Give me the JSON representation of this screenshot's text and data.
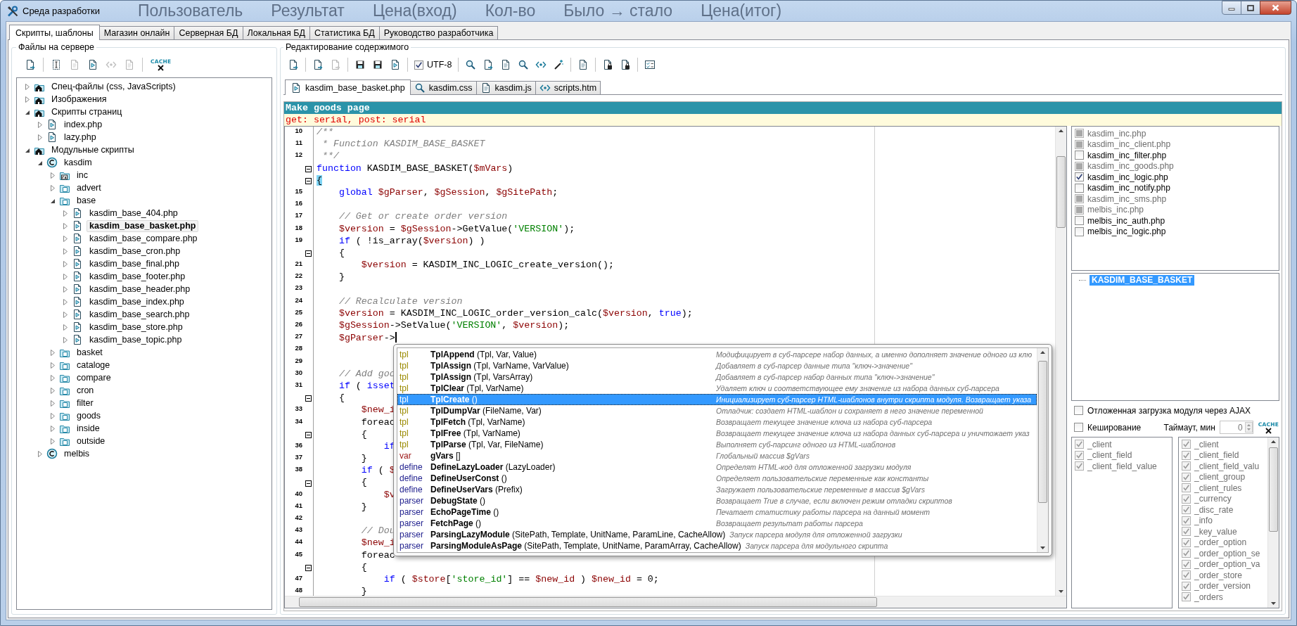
{
  "window": {
    "title": "Среда разработки",
    "backdrop_texts": [
      "Пользователь",
      "Результат",
      "Цена(вход)",
      "Кол-во",
      "Было → стало",
      "Цена(итог)"
    ]
  },
  "tabs": [
    {
      "label": "Скрипты, шаблоны",
      "selected": true
    },
    {
      "label": "Магазин онлайн",
      "selected": false
    },
    {
      "label": "Серверная БД",
      "selected": false
    },
    {
      "label": "Локальная БД",
      "selected": false
    },
    {
      "label": "Статистика БД",
      "selected": false
    },
    {
      "label": "Руководство разработчика",
      "selected": false
    }
  ],
  "files_panel": {
    "title": "Файлы на сервере",
    "toolbar": [
      [
        {
          "kind": "button",
          "disabled": false
        }
      ],
      [
        {
          "kind": "button",
          "disabled": false
        },
        {
          "kind": "button",
          "disabled": true
        },
        {
          "kind": "button",
          "disabled": false
        },
        {
          "kind": "button",
          "disabled": true
        },
        {
          "kind": "button",
          "disabled": true
        }
      ],
      [
        {
          "kind": "cache",
          "label": "CACHE"
        }
      ]
    ],
    "tree": [
      {
        "kind": "section",
        "label": "Спец-файлы (css, JavaScripts)",
        "expanded": false,
        "selected": false
      },
      {
        "kind": "section",
        "label": "Изображения",
        "expanded": false,
        "selected": false
      },
      {
        "kind": "section",
        "label": "Скрипты страниц",
        "expanded": true,
        "selected": false,
        "children": [
          {
            "kind": "file",
            "label": "index.php",
            "expanded": false,
            "selected": false
          },
          {
            "kind": "file",
            "label": "lazy.php",
            "expanded": false,
            "selected": false
          }
        ]
      },
      {
        "kind": "section",
        "label": "Модульные скрипты",
        "expanded": true,
        "selected": false,
        "children": [
          {
            "kind": "module",
            "label": "kasdim",
            "expanded": true,
            "selected": false,
            "children": [
              {
                "kind": "library",
                "label": "inc",
                "expanded": false,
                "selected": false
              },
              {
                "kind": "folder",
                "label": "advert",
                "expanded": false,
                "selected": false
              },
              {
                "kind": "folder",
                "label": "base",
                "expanded": true,
                "selected": false,
                "children": [
                  {
                    "kind": "file",
                    "label": "kasdim_base_404.php",
                    "expanded": false,
                    "selected": false
                  },
                  {
                    "kind": "file",
                    "label": "kasdim_base_basket.php",
                    "expanded": false,
                    "selected": true
                  },
                  {
                    "kind": "file",
                    "label": "kasdim_base_compare.php",
                    "expanded": false,
                    "selected": false
                  },
                  {
                    "kind": "file",
                    "label": "kasdim_base_cron.php",
                    "expanded": false,
                    "selected": false
                  },
                  {
                    "kind": "file",
                    "label": "kasdim_base_final.php",
                    "expanded": false,
                    "selected": false
                  },
                  {
                    "kind": "file",
                    "label": "kasdim_base_footer.php",
                    "expanded": false,
                    "selected": false
                  },
                  {
                    "kind": "file",
                    "label": "kasdim_base_header.php",
                    "expanded": false,
                    "selected": false
                  },
                  {
                    "kind": "file",
                    "label": "kasdim_base_index.php",
                    "expanded": false,
                    "selected": false
                  },
                  {
                    "kind": "file",
                    "label": "kasdim_base_search.php",
                    "expanded": false,
                    "selected": false
                  },
                  {
                    "kind": "file",
                    "label": "kasdim_base_store.php",
                    "expanded": false,
                    "selected": false
                  },
                  {
                    "kind": "file",
                    "label": "kasdim_base_topic.php",
                    "expanded": false,
                    "selected": false
                  }
                ]
              },
              {
                "kind": "folder",
                "label": "basket",
                "expanded": false,
                "selected": false
              },
              {
                "kind": "folder",
                "label": "cataloge",
                "expanded": false,
                "selected": false
              },
              {
                "kind": "folder",
                "label": "compare",
                "expanded": false,
                "selected": false
              },
              {
                "kind": "folder",
                "label": "cron",
                "expanded": false,
                "selected": false
              },
              {
                "kind": "folder",
                "label": "filter",
                "expanded": false,
                "selected": false
              },
              {
                "kind": "folder",
                "label": "goods",
                "expanded": false,
                "selected": false
              },
              {
                "kind": "folder",
                "label": "inside",
                "expanded": false,
                "selected": false
              },
              {
                "kind": "folder",
                "label": "outside",
                "expanded": false,
                "selected": false
              }
            ]
          },
          {
            "kind": "module",
            "label": "melbis",
            "expanded": false,
            "selected": false
          }
        ]
      }
    ]
  },
  "editor_panel": {
    "title": "Редактирование содержимого",
    "toolbar": [
      [
        {
          "kind": "button",
          "disabled": false
        }
      ],
      [
        {
          "kind": "button",
          "disabled": false
        },
        {
          "kind": "button",
          "disabled": true
        }
      ],
      [
        {
          "kind": "button",
          "disabled": false
        },
        {
          "kind": "button",
          "disabled": false
        },
        {
          "kind": "button",
          "disabled": false
        }
      ],
      [
        {
          "kind": "checkbox",
          "label": "UTF-8",
          "checked": true
        }
      ],
      [
        {
          "kind": "button",
          "disabled": false
        },
        {
          "kind": "button",
          "disabled": false
        },
        {
          "kind": "button",
          "disabled": false
        },
        {
          "kind": "button",
          "disabled": false
        },
        {
          "kind": "button",
          "disabled": false
        },
        {
          "kind": "button",
          "disabled": false
        }
      ],
      [
        {
          "kind": "button",
          "disabled": false
        }
      ],
      [
        {
          "kind": "button",
          "disabled": false
        },
        {
          "kind": "button",
          "disabled": false
        }
      ],
      [
        {
          "kind": "button",
          "disabled": false
        }
      ]
    ],
    "file_tabs": [
      {
        "label": "kasdim_base_basket.php",
        "selected": true
      },
      {
        "label": "kasdim.css",
        "selected": false
      },
      {
        "label": "kasdim.js",
        "selected": false
      },
      {
        "label": "scripts.htm",
        "selected": false
      }
    ],
    "header": "Make goods page",
    "params": "get: serial, post: serial",
    "lines": [
      {
        "number": "10",
        "fold": false,
        "tokens": [
          {
            "kind": "comment",
            "text": "/**"
          }
        ]
      },
      {
        "number": "11",
        "fold": false,
        "tokens": [
          {
            "kind": "comment",
            "text": " * Function KASDIM_BASE_BASKET"
          }
        ]
      },
      {
        "number": "12",
        "fold": false,
        "tokens": [
          {
            "kind": "comment",
            "text": " **/"
          }
        ]
      },
      {
        "fold": true,
        "tokens": [
          {
            "kind": "keyword",
            "text": "function"
          },
          {
            "kind": "plain",
            "text": " KASDIM_BASE_BASKET("
          },
          {
            "kind": "variable",
            "text": "$mVars"
          },
          {
            "kind": "plain",
            "text": ")"
          }
        ]
      },
      {
        "fold": true,
        "tokens": [
          {
            "kind": "brace",
            "text": "{"
          }
        ]
      },
      {
        "number": "15",
        "fold": false,
        "tokens": [
          {
            "kind": "keyword",
            "text": "    global"
          },
          {
            "kind": "variable",
            "text": " $gParser"
          },
          {
            "kind": "plain",
            "text": ", "
          },
          {
            "kind": "variable",
            "text": "$gSession"
          },
          {
            "kind": "plain",
            "text": ", "
          },
          {
            "kind": "variable",
            "text": "$gSitePath"
          },
          {
            "kind": "plain",
            "text": ";"
          }
        ]
      },
      {
        "number": "16",
        "fold": false
      },
      {
        "number": "17",
        "fold": false,
        "tokens": [
          {
            "kind": "comment",
            "text": "    // Get or create order version"
          }
        ]
      },
      {
        "number": "18",
        "fold": false,
        "tokens": [
          {
            "kind": "variable",
            "text": "    $version"
          },
          {
            "kind": "plain",
            "text": " = "
          },
          {
            "kind": "variable",
            "text": "$gSession"
          },
          {
            "kind": "plain",
            "text": "->GetValue("
          },
          {
            "kind": "string",
            "text": "'VERSION'"
          },
          {
            "kind": "plain",
            "text": ");"
          }
        ]
      },
      {
        "number": "19",
        "fold": false,
        "tokens": [
          {
            "kind": "keyword",
            "text": "    if"
          },
          {
            "kind": "plain",
            "text": " ( !is_array("
          },
          {
            "kind": "variable",
            "text": "$version"
          },
          {
            "kind": "plain",
            "text": ") )"
          }
        ]
      },
      {
        "fold": true,
        "tokens": [
          {
            "kind": "plain",
            "text": "    {"
          }
        ]
      },
      {
        "number": "21",
        "fold": false,
        "tokens": [
          {
            "kind": "variable",
            "text": "        $version"
          },
          {
            "kind": "plain",
            "text": " = KASDIM_INC_LOGIC_create_version();"
          }
        ]
      },
      {
        "number": "22",
        "fold": false,
        "tokens": [
          {
            "kind": "plain",
            "text": "    }"
          }
        ]
      },
      {
        "number": "23",
        "fold": false
      },
      {
        "number": "24",
        "fold": false,
        "tokens": [
          {
            "kind": "comment",
            "text": "    // Recalculate version"
          }
        ]
      },
      {
        "number": "25",
        "fold": false,
        "tokens": [
          {
            "kind": "variable",
            "text": "    $version"
          },
          {
            "kind": "plain",
            "text": " = KASDIM_INC_LOGIC_order_version_calc("
          },
          {
            "kind": "variable",
            "text": "$version"
          },
          {
            "kind": "plain",
            "text": ", "
          },
          {
            "kind": "keyword",
            "text": "true"
          },
          {
            "kind": "plain",
            "text": ");"
          }
        ]
      },
      {
        "number": "26",
        "fold": false,
        "tokens": [
          {
            "kind": "variable",
            "text": "    $gSession"
          },
          {
            "kind": "plain",
            "text": "->SetValue("
          },
          {
            "kind": "string",
            "text": "'VERSION'"
          },
          {
            "kind": "plain",
            "text": ", "
          },
          {
            "kind": "variable",
            "text": "$version"
          },
          {
            "kind": "plain",
            "text": ");"
          }
        ]
      },
      {
        "number": "27",
        "fold": false,
        "cursor": true,
        "tokens": [
          {
            "kind": "variable",
            "text": "    $gParser"
          },
          {
            "kind": "plain",
            "text": "->"
          }
        ]
      },
      {
        "number": "28",
        "fold": false
      },
      {
        "number": "29",
        "fold": false
      },
      {
        "number": "30",
        "fold": false,
        "tokens": [
          {
            "kind": "comment",
            "text": "    // Add goo"
          }
        ]
      },
      {
        "number": "31",
        "fold": false,
        "tokens": [
          {
            "kind": "keyword",
            "text": "    if"
          },
          {
            "kind": "plain",
            "text": " ( "
          },
          {
            "kind": "keyword",
            "text": "isset"
          }
        ]
      },
      {
        "fold": true,
        "tokens": [
          {
            "kind": "plain",
            "text": "    {"
          }
        ]
      },
      {
        "number": "33",
        "fold": false,
        "tokens": [
          {
            "kind": "variable",
            "text": "        $new_i"
          }
        ]
      },
      {
        "number": "34",
        "fold": false,
        "tokens": [
          {
            "kind": "plain",
            "text": "        foreac"
          }
        ]
      },
      {
        "fold": true,
        "tokens": [
          {
            "kind": "plain",
            "text": "        {"
          }
        ]
      },
      {
        "number": "36",
        "fold": false,
        "tokens": [
          {
            "kind": "keyword",
            "text": "            if"
          }
        ]
      },
      {
        "number": "37",
        "fold": false,
        "tokens": [
          {
            "kind": "plain",
            "text": "        }"
          }
        ]
      },
      {
        "number": "38",
        "fold": false,
        "tokens": [
          {
            "kind": "keyword",
            "text": "        if"
          },
          {
            "kind": "plain",
            "text": " ( "
          },
          {
            "kind": "variable",
            "text": "$"
          }
        ]
      },
      {
        "fold": true,
        "tokens": [
          {
            "kind": "plain",
            "text": "        {"
          }
        ]
      },
      {
        "number": "40",
        "fold": false,
        "tokens": [
          {
            "kind": "variable",
            "text": "            $v"
          }
        ]
      },
      {
        "number": "41",
        "fold": false,
        "tokens": [
          {
            "kind": "plain",
            "text": "        }"
          }
        ]
      },
      {
        "number": "42",
        "fold": false
      },
      {
        "number": "43",
        "fold": false,
        "tokens": [
          {
            "kind": "comment",
            "text": "        // Dou"
          }
        ]
      },
      {
        "number": "44",
        "fold": false,
        "tokens": [
          {
            "kind": "variable",
            "text": "        $new_i"
          }
        ]
      },
      {
        "number": "45",
        "fold": false,
        "tokens": [
          {
            "kind": "plain",
            "text": "        foreac"
          }
        ]
      },
      {
        "fold": true,
        "tokens": [
          {
            "kind": "plain",
            "text": "        {"
          }
        ]
      },
      {
        "number": "47",
        "fold": false,
        "tokens": [
          {
            "kind": "keyword",
            "text": "            if"
          },
          {
            "kind": "plain",
            "text": " ( "
          },
          {
            "kind": "variable",
            "text": "$store"
          },
          {
            "kind": "plain",
            "text": "["
          },
          {
            "kind": "string",
            "text": "'store_id'"
          },
          {
            "kind": "plain",
            "text": "] == "
          },
          {
            "kind": "variable",
            "text": "$new_id"
          },
          {
            "kind": "plain",
            "text": " ) "
          },
          {
            "kind": "variable",
            "text": "$new_id"
          },
          {
            "kind": "plain",
            "text": " = 0;"
          }
        ]
      },
      {
        "number": "48",
        "fold": false,
        "tokens": [
          {
            "kind": "plain",
            "text": "        }"
          }
        ]
      }
    ],
    "completion": {
      "items": [
        {
          "kind": "tpl",
          "name": "TplAppend",
          "params": "(Tpl, Var, Value)",
          "description": "Модифицирует в суб-парсере набор данных, а именно дополняет значение одного из клю",
          "selected": false
        },
        {
          "kind": "tpl",
          "name": "TplAssign",
          "params": "(Tpl, VarName, VarValue)",
          "description": "Добавляет в суб-парсер данные типа \"ключ->значение\"",
          "selected": false
        },
        {
          "kind": "tpl",
          "name": "TplAssign",
          "params": "(Tpl, VarsArray)",
          "description": "Добавляет в суб-парсер набор данных типа \"ключ->значение\"",
          "selected": false
        },
        {
          "kind": "tpl",
          "name": "TplClear",
          "params": "(Tpl, VarName)",
          "description": "Удаляет ключ и соответствующее ему значение из набора данных суб-парсера",
          "selected": false
        },
        {
          "kind": "tpl",
          "name": "TplCreate",
          "params": "()",
          "description": "Инициализирует суб-парсер HTML-шаблонов внутри скрипта модуля. Возвращает указа",
          "selected": true
        },
        {
          "kind": "tpl",
          "name": "TplDumpVar",
          "params": "(FileName, Var)",
          "description": "Отладчик: создает HTML-шаблон и сохраняет в него значение переменной",
          "selected": false
        },
        {
          "kind": "tpl",
          "name": "TplFetch",
          "params": "(Tpl, VarName)",
          "description": "Возвращает текущее значение ключа из набора суб-парсера",
          "selected": false
        },
        {
          "kind": "tpl",
          "name": "TplFree",
          "params": "(Tpl, VarName)",
          "description": "Возвращает текущее значение ключа из набора данных суб-парсера и уничтожает указ",
          "selected": false
        },
        {
          "kind": "tpl",
          "name": "TplParse",
          "params": "(Tpl, Var, FileName)",
          "description": "Выполняет суб-парсинг одного из HTML-шаблонов",
          "selected": false
        },
        {
          "kind": "var",
          "name": "gVars",
          "params": "[]",
          "description": "Глобальный массив $gVars",
          "selected": false
        },
        {
          "kind": "define",
          "name": "DefineLazyLoader",
          "params": "(LazyLoader)",
          "description": "Определят HTML-код для отложенной загрузки модуля",
          "selected": false
        },
        {
          "kind": "define",
          "name": "DefineUserConst",
          "params": "()",
          "description": "Определяет пользовательские переменные как константы",
          "selected": false
        },
        {
          "kind": "define",
          "name": "DefineUserVars",
          "params": "(Prefix)",
          "description": "Загружает пользовательские переменные в массив $gVars",
          "selected": false
        },
        {
          "kind": "parser",
          "name": "DebugState",
          "params": "()",
          "description": "Возвращает True в случае, если включен режим отладки скриптов",
          "selected": false
        },
        {
          "kind": "parser",
          "name": "EchoPageTime",
          "params": "()",
          "description": "Печатает статистику работы парсера на данный момент",
          "selected": false
        },
        {
          "kind": "parser",
          "name": "FetchPage",
          "params": "()",
          "description": "Возвращает результат работы парсера",
          "selected": false
        },
        {
          "kind": "parser",
          "name": "ParsingLazyModule",
          "params": "(SitePath, Template, UnitName, ParamLine, CacheAllow)",
          "description": "Запуск парсера модуля для отложенной загрузки",
          "selected": false
        },
        {
          "kind": "parser",
          "name": "ParsingModuleAsPage",
          "params": "(SitePath, Template, UnitName, ParamArray, CacheAllow)",
          "description": "Запуск парсера для модульного скрипта",
          "selected": false
        }
      ]
    }
  },
  "side_panel": {
    "modules": [
      {
        "label": "kasdim_inc.php",
        "checked": false,
        "disabled": true
      },
      {
        "label": "kasdim_inc_client.php",
        "checked": false,
        "disabled": true
      },
      {
        "label": "kasdim_inc_filter.php",
        "checked": false,
        "disabled": false
      },
      {
        "label": "kasdim_inc_goods.php",
        "checked": false,
        "disabled": true
      },
      {
        "label": "kasdim_inc_logic.php",
        "checked": true,
        "disabled": false
      },
      {
        "label": "kasdim_inc_notify.php",
        "checked": false,
        "disabled": false
      },
      {
        "label": "kasdim_inc_sms.php",
        "checked": false,
        "disabled": true
      },
      {
        "label": "melbis_inc.php",
        "checked": false,
        "disabled": true
      },
      {
        "label": "melbis_inc_auth.php",
        "checked": false,
        "disabled": false
      },
      {
        "label": "melbis_inc_logic.php",
        "checked": false,
        "disabled": false
      }
    ],
    "functions": [
      {
        "label": "KASDIM_BASE_BASKET",
        "selected": true
      }
    ],
    "ajax": {
      "label": "Отложенная загрузка модуля через AJAX",
      "checked": false
    },
    "caching": {
      "label": "Кеширование",
      "checked": false
    },
    "timeout": {
      "label": "Таймаут, мин",
      "value": "0"
    },
    "cache_label": "CACHE",
    "tables_left": [
      {
        "label": "_client",
        "checked": true,
        "disabled": true
      },
      {
        "label": "_client_field",
        "checked": true,
        "disabled": true
      },
      {
        "label": "_client_field_value",
        "checked": true,
        "disabled": true
      }
    ],
    "tables_right": [
      {
        "label": "_client",
        "checked": true,
        "disabled": true
      },
      {
        "label": "_client_field",
        "checked": true,
        "disabled": true
      },
      {
        "label": "_client_field_valu",
        "checked": true,
        "disabled": true
      },
      {
        "label": "_client_group",
        "checked": true,
        "disabled": true
      },
      {
        "label": "_client_rules",
        "checked": true,
        "disabled": true
      },
      {
        "label": "_currency",
        "checked": true,
        "disabled": true
      },
      {
        "label": "_disc_rate",
        "checked": true,
        "disabled": true
      },
      {
        "label": "_info",
        "checked": true,
        "disabled": true
      },
      {
        "label": "_key_value",
        "checked": true,
        "disabled": true
      },
      {
        "label": "_order_option",
        "checked": true,
        "disabled": true
      },
      {
        "label": "_order_option_se",
        "checked": true,
        "disabled": true
      },
      {
        "label": "_order_option_va",
        "checked": true,
        "disabled": true
      },
      {
        "label": "_order_store",
        "checked": true,
        "disabled": true
      },
      {
        "label": "_order_version",
        "checked": true,
        "disabled": true
      },
      {
        "label": "_orders",
        "checked": true,
        "disabled": true
      }
    ]
  }
}
